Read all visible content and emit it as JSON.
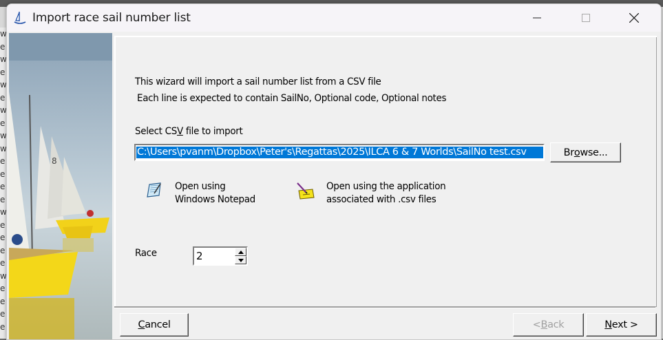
{
  "window": {
    "title": "Import race sail number list"
  },
  "wizard": {
    "intro_line1": "This wizard will import a sail number list from a CSV file",
    "intro_line2": "Each line is expected to contain SailNo, Optional code, Optional notes",
    "select_label_pre": "Select CS",
    "select_label_accel": "V",
    "select_label_post": " file to import",
    "file_path": "C:\\Users\\pvanm\\Dropbox\\Peter's\\Regattas\\2025\\ILCA 6 & 7 Worlds\\SailNo test.csv",
    "browse_pre": "Br",
    "browse_accel": "o",
    "browse_post": "wse...",
    "notepad_line1": "Open using",
    "notepad_line2": "Windows Notepad",
    "assoc_line1": "Open using the application",
    "assoc_line2": "associated with .csv files",
    "race_label": "Race",
    "race_value": "2"
  },
  "footer": {
    "cancel_accel": "C",
    "cancel_rest": "ancel",
    "back_pre": "< ",
    "back_accel": "B",
    "back_rest": "ack",
    "next_accel": "N",
    "next_rest": "ext >"
  },
  "background": {
    "left_letters": [
      "w",
      "e",
      "w",
      "e",
      "w",
      "e",
      "w",
      "e",
      "w",
      "w",
      "e",
      "e",
      "e",
      "e",
      "w",
      "e",
      "e",
      "e",
      "e",
      "w",
      "e",
      "e",
      "e",
      "e"
    ]
  },
  "icons": {
    "app": "sailboat-icon",
    "notepad": "notepad-icon",
    "assoc": "pencil-folder-icon"
  },
  "colors": {
    "selection": "#0078d7",
    "disabled_text": "#a0a0a0"
  }
}
